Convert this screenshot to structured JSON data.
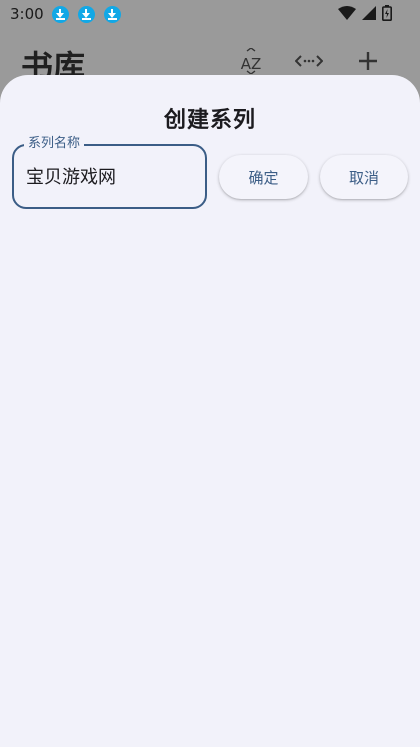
{
  "status_bar": {
    "time": "3:00",
    "icons": [
      "download-icon",
      "download-icon",
      "download-icon",
      "wifi-icon",
      "signal-icon",
      "battery-icon"
    ]
  },
  "app_bar": {
    "title": "书库",
    "actions": [
      "sort-az-icon",
      "expand-horizontal-icon",
      "add-icon"
    ],
    "sort_glyph": "AZ"
  },
  "dialog": {
    "title": "创建系列",
    "name_field": {
      "label": "系列名称",
      "value": "宝贝游戏网"
    },
    "confirm_label": "确定",
    "cancel_label": "取消"
  },
  "colors": {
    "accent": "#3b5d86",
    "sheet_background": "#f2f2fa",
    "download_badge": "#12a8e6"
  }
}
